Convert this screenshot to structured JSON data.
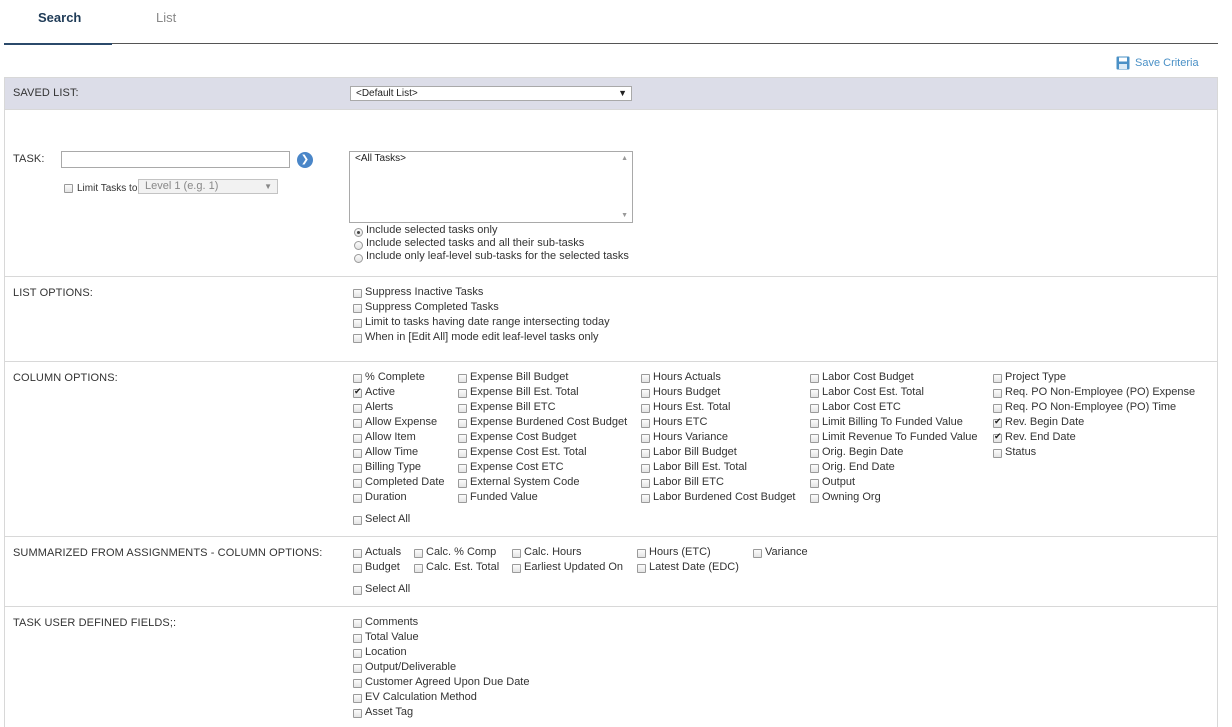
{
  "tabs": [
    {
      "label": "Search",
      "active": true
    },
    {
      "label": "List",
      "active": false
    }
  ],
  "save_criteria": "Save Criteria",
  "saved_list": {
    "label": "SAVED LIST:",
    "value": "<Default List>"
  },
  "task": {
    "label": "TASK:",
    "input_value": "",
    "limit_label": "Limit Tasks to",
    "level_value": "Level 1 (e.g. 1)",
    "list_items": [
      "<All Tasks>"
    ],
    "radios": [
      {
        "label": "Include selected tasks only",
        "checked": true
      },
      {
        "label": "Include selected tasks and all their sub-tasks",
        "checked": false
      },
      {
        "label": "Include only leaf-level sub-tasks for the selected tasks",
        "checked": false
      }
    ]
  },
  "list_options": {
    "label": "LIST OPTIONS:",
    "items": [
      {
        "label": "Suppress Inactive Tasks",
        "checked": false
      },
      {
        "label": "Suppress Completed Tasks",
        "checked": false
      },
      {
        "label": "Limit to tasks having date range intersecting today",
        "checked": false
      },
      {
        "label": "When in [Edit All] mode edit leaf-level tasks only",
        "checked": false
      }
    ]
  },
  "column_options": {
    "label": "COLUMN OPTIONS:",
    "columns": [
      [
        {
          "label": "% Complete",
          "checked": false
        },
        {
          "label": "Active",
          "checked": true
        },
        {
          "label": "Alerts",
          "checked": false
        },
        {
          "label": "Allow Expense",
          "checked": false
        },
        {
          "label": "Allow Item",
          "checked": false
        },
        {
          "label": "Allow Time",
          "checked": false
        },
        {
          "label": "Billing Type",
          "checked": false
        },
        {
          "label": "Completed Date",
          "checked": false
        },
        {
          "label": "Duration",
          "checked": false
        }
      ],
      [
        {
          "label": "Expense Bill Budget",
          "checked": false
        },
        {
          "label": "Expense Bill Est. Total",
          "checked": false
        },
        {
          "label": "Expense Bill ETC",
          "checked": false
        },
        {
          "label": "Expense Burdened Cost Budget",
          "checked": false
        },
        {
          "label": "Expense Cost Budget",
          "checked": false
        },
        {
          "label": "Expense Cost Est. Total",
          "checked": false
        },
        {
          "label": "Expense Cost ETC",
          "checked": false
        },
        {
          "label": "External System Code",
          "checked": false
        },
        {
          "label": "Funded Value",
          "checked": false
        }
      ],
      [
        {
          "label": "Hours Actuals",
          "checked": false
        },
        {
          "label": "Hours Budget",
          "checked": false
        },
        {
          "label": "Hours Est. Total",
          "checked": false
        },
        {
          "label": "Hours ETC",
          "checked": false
        },
        {
          "label": "Hours Variance",
          "checked": false
        },
        {
          "label": "Labor Bill Budget",
          "checked": false
        },
        {
          "label": "Labor Bill Est. Total",
          "checked": false
        },
        {
          "label": "Labor Bill ETC",
          "checked": false
        },
        {
          "label": "Labor Burdened Cost Budget",
          "checked": false
        }
      ],
      [
        {
          "label": "Labor Cost Budget",
          "checked": false
        },
        {
          "label": "Labor Cost Est. Total",
          "checked": false
        },
        {
          "label": "Labor Cost ETC",
          "checked": false
        },
        {
          "label": "Limit Billing To Funded Value",
          "checked": false
        },
        {
          "label": "Limit Revenue To Funded Value",
          "checked": false
        },
        {
          "label": "Orig. Begin Date",
          "checked": false
        },
        {
          "label": "Orig. End Date",
          "checked": false
        },
        {
          "label": "Output",
          "checked": false
        },
        {
          "label": "Owning Org",
          "checked": false
        }
      ],
      [
        {
          "label": "Project Type",
          "checked": false
        },
        {
          "label": "Req. PO Non-Employee (PO) Expense",
          "checked": false
        },
        {
          "label": "Req. PO Non-Employee (PO) Time",
          "checked": false
        },
        {
          "label": "Rev. Begin Date",
          "checked": true
        },
        {
          "label": "Rev. End Date",
          "checked": true
        },
        {
          "label": "Status",
          "checked": false
        }
      ]
    ],
    "select_all": "Select All"
  },
  "summarized": {
    "label": "SUMMARIZED FROM ASSIGNMENTS - COLUMN OPTIONS:",
    "rows": [
      [
        {
          "label": "Actuals",
          "checked": false
        },
        {
          "label": "Calc. % Comp",
          "checked": false
        },
        {
          "label": "Calc. Hours",
          "checked": false
        },
        {
          "label": "Hours (ETC)",
          "checked": false
        },
        {
          "label": "Variance",
          "checked": false
        }
      ],
      [
        {
          "label": "Budget",
          "checked": false
        },
        {
          "label": "Calc. Est. Total",
          "checked": false
        },
        {
          "label": "Earliest Updated On",
          "checked": false
        },
        {
          "label": "Latest Date (EDC)",
          "checked": false
        }
      ]
    ],
    "select_all": "Select All"
  },
  "user_fields": {
    "label": "TASK USER DEFINED FIELDS;:",
    "items": [
      {
        "label": "Comments",
        "checked": false
      },
      {
        "label": "Total Value",
        "checked": false
      },
      {
        "label": "Location",
        "checked": false
      },
      {
        "label": "Output/Deliverable",
        "checked": false
      },
      {
        "label": "Customer Agreed Upon Due Date",
        "checked": false
      },
      {
        "label": "EV Calculation Method",
        "checked": false
      },
      {
        "label": "Asset Tag",
        "checked": false
      }
    ]
  }
}
